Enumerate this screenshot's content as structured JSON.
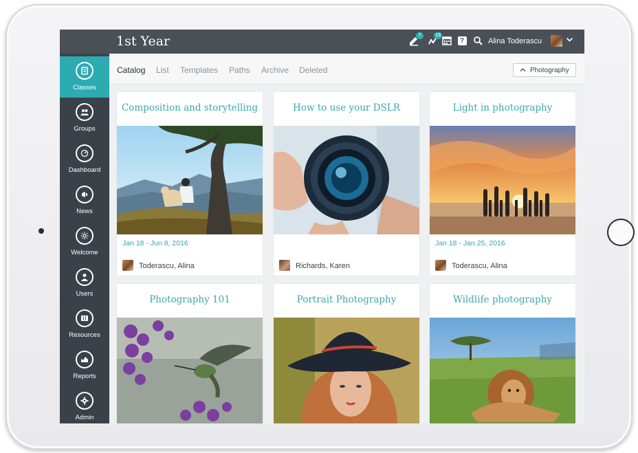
{
  "app": {
    "title": "1st Year"
  },
  "header": {
    "user_name": "Alina Toderascu",
    "icons": [
      {
        "name": "edit-icon",
        "badge": "7"
      },
      {
        "name": "notifications-icon",
        "badge": "19"
      },
      {
        "name": "calendar-icon",
        "badge": ""
      },
      {
        "name": "help-icon",
        "badge": ""
      },
      {
        "name": "search-icon",
        "badge": ""
      }
    ],
    "help_glyph": "?"
  },
  "sidebar": {
    "items": [
      {
        "label": "Classes",
        "icon": "classes-icon",
        "active": true
      },
      {
        "label": "Groups",
        "icon": "groups-icon",
        "active": false
      },
      {
        "label": "Dashboard",
        "icon": "dashboard-icon",
        "active": false
      },
      {
        "label": "News",
        "icon": "news-icon",
        "active": false
      },
      {
        "label": "Welcome",
        "icon": "welcome-icon",
        "active": false
      },
      {
        "label": "Users",
        "icon": "users-icon",
        "active": false
      },
      {
        "label": "Resources",
        "icon": "resources-icon",
        "active": false
      },
      {
        "label": "Reports",
        "icon": "reports-icon",
        "active": false
      },
      {
        "label": "Admin",
        "icon": "admin-icon",
        "active": false
      }
    ]
  },
  "tabs": {
    "items": [
      "Catalog",
      "List",
      "Templates",
      "Paths",
      "Archive",
      "Deleted"
    ],
    "active": "Catalog",
    "filter_label": "Photography"
  },
  "cards": [
    {
      "title": "Composition and storytelling",
      "date": "Jan 18 - Jun 8, 2016",
      "owner": "Toderascu, Alina",
      "image": "tree-landscape"
    },
    {
      "title": "How to use your DSLR",
      "date": "",
      "owner": "Richards, Karen",
      "image": "camera-lens"
    },
    {
      "title": "Light in photography",
      "date": "Jan 18 - Jan 25, 2016",
      "owner": "Toderascu, Alina",
      "image": "sunset-surfboards"
    },
    {
      "title": "Photography 101",
      "date": "",
      "owner": "",
      "image": "hummingbird"
    },
    {
      "title": "Portrait Photography",
      "date": "",
      "owner": "",
      "image": "portrait-hat"
    },
    {
      "title": "Wildlife photography",
      "date": "",
      "owner": "",
      "image": "lion"
    }
  ],
  "colors": {
    "accent": "#2cabb1",
    "topbar": "#4a5056",
    "sidebar": "#3b4148",
    "card_title": "#3aa9ae"
  }
}
